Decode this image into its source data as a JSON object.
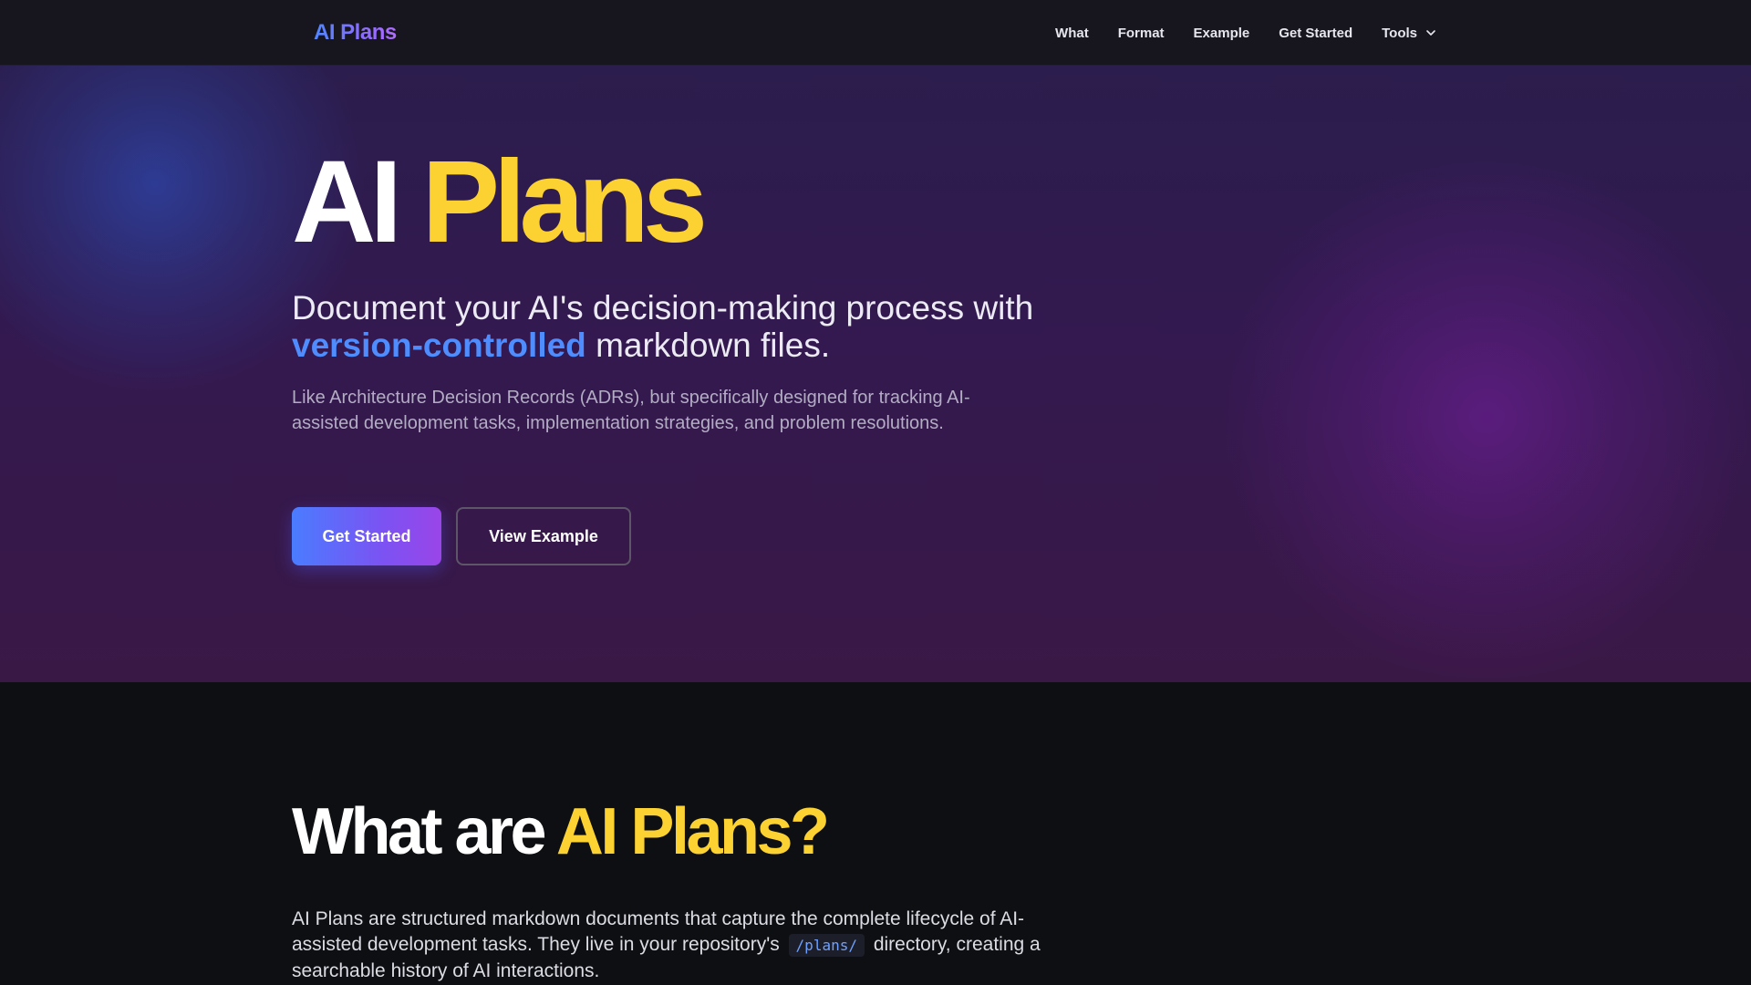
{
  "nav": {
    "logo": "AI Plans",
    "links": [
      "What",
      "Format",
      "Example",
      "Get Started"
    ],
    "tools_label": "Tools",
    "tools_icon": "chevron-down-icon"
  },
  "hero": {
    "title_part1": "AI",
    "title_part2": "Plans",
    "subtitle_before": "Document your AI's decision-making process with",
    "subtitle_accent": "version-controlled",
    "subtitle_after": "markdown files.",
    "description": "Like Architecture Decision Records (ADRs), but specifically designed for tracking AI-assisted development tasks, implementation strategies, and problem resolutions.",
    "primary_button": "Get Started",
    "secondary_button": "View Example"
  },
  "what": {
    "title_part1": "What are",
    "title_part2": "AI Plans?",
    "body_before": "AI Plans are structured markdown documents that capture the complete lifecycle of AI-assisted development tasks. They live in your repository's",
    "body_code": "/plans/",
    "body_after": "directory, creating a searchable history of AI interactions."
  },
  "colors": {
    "accent_blue": "#4f8dff",
    "accent_yellow": "#fcd232",
    "nav_bg": "#17161f",
    "hero_bg": "#33194f",
    "section_bg": "#0e0f12"
  }
}
